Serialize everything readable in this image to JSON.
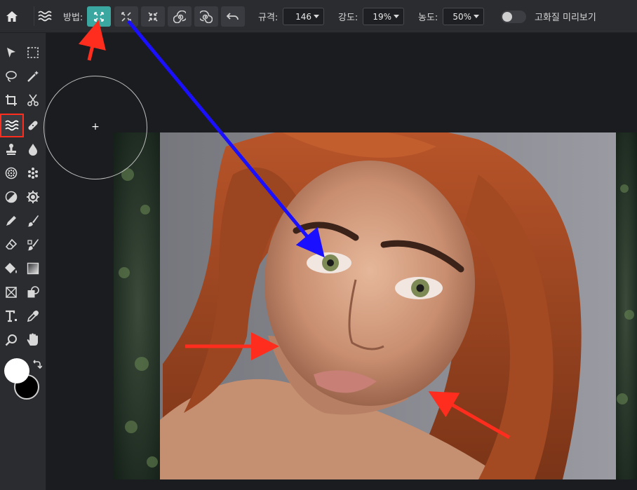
{
  "toolbar": {
    "method_label": "방법:",
    "scale_label": "규격:",
    "scale_value": "146",
    "strength_label": "강도:",
    "strength_value": "19%",
    "density_label": "농도:",
    "density_value": "50%",
    "hq_preview_label": "고화질 미리보기",
    "hq_preview_enabled": false,
    "accent_color": "#3aa7a0"
  },
  "method_buttons": [
    {
      "icon": "expand-icon",
      "active": true
    },
    {
      "icon": "expand-diagonal-icon",
      "active": false
    },
    {
      "icon": "shrink-icon",
      "active": false
    },
    {
      "icon": "twirl-right-icon",
      "active": false
    },
    {
      "icon": "twirl-left-icon",
      "active": false
    },
    {
      "icon": "undo-icon",
      "active": false
    }
  ],
  "tools": [
    "move-icon",
    "marquee-icon",
    "lasso-icon",
    "magic-wand-icon",
    "crop-icon",
    "scissors-icon",
    "liquify-icon",
    "bandage-icon",
    "stamp-icon",
    "blur-drop-icon",
    "sponge-icon",
    "dots-icon",
    "dodge-burn-icon",
    "sharpen-gear-icon",
    "pen-icon",
    "brush-icon",
    "eraser-icon",
    "color-replace-icon",
    "paint-bucket-icon",
    "gradient-icon",
    "frame-icon",
    "shape-icon",
    "text-icon",
    "eyedropper-icon",
    "zoom-icon",
    "hand-icon"
  ],
  "selected_tool": "liquify-icon",
  "colors": {
    "foreground": "#ffffff",
    "background": "#000000",
    "annotation_red": "#ff2d1d",
    "annotation_blue": "#1a10ff"
  }
}
